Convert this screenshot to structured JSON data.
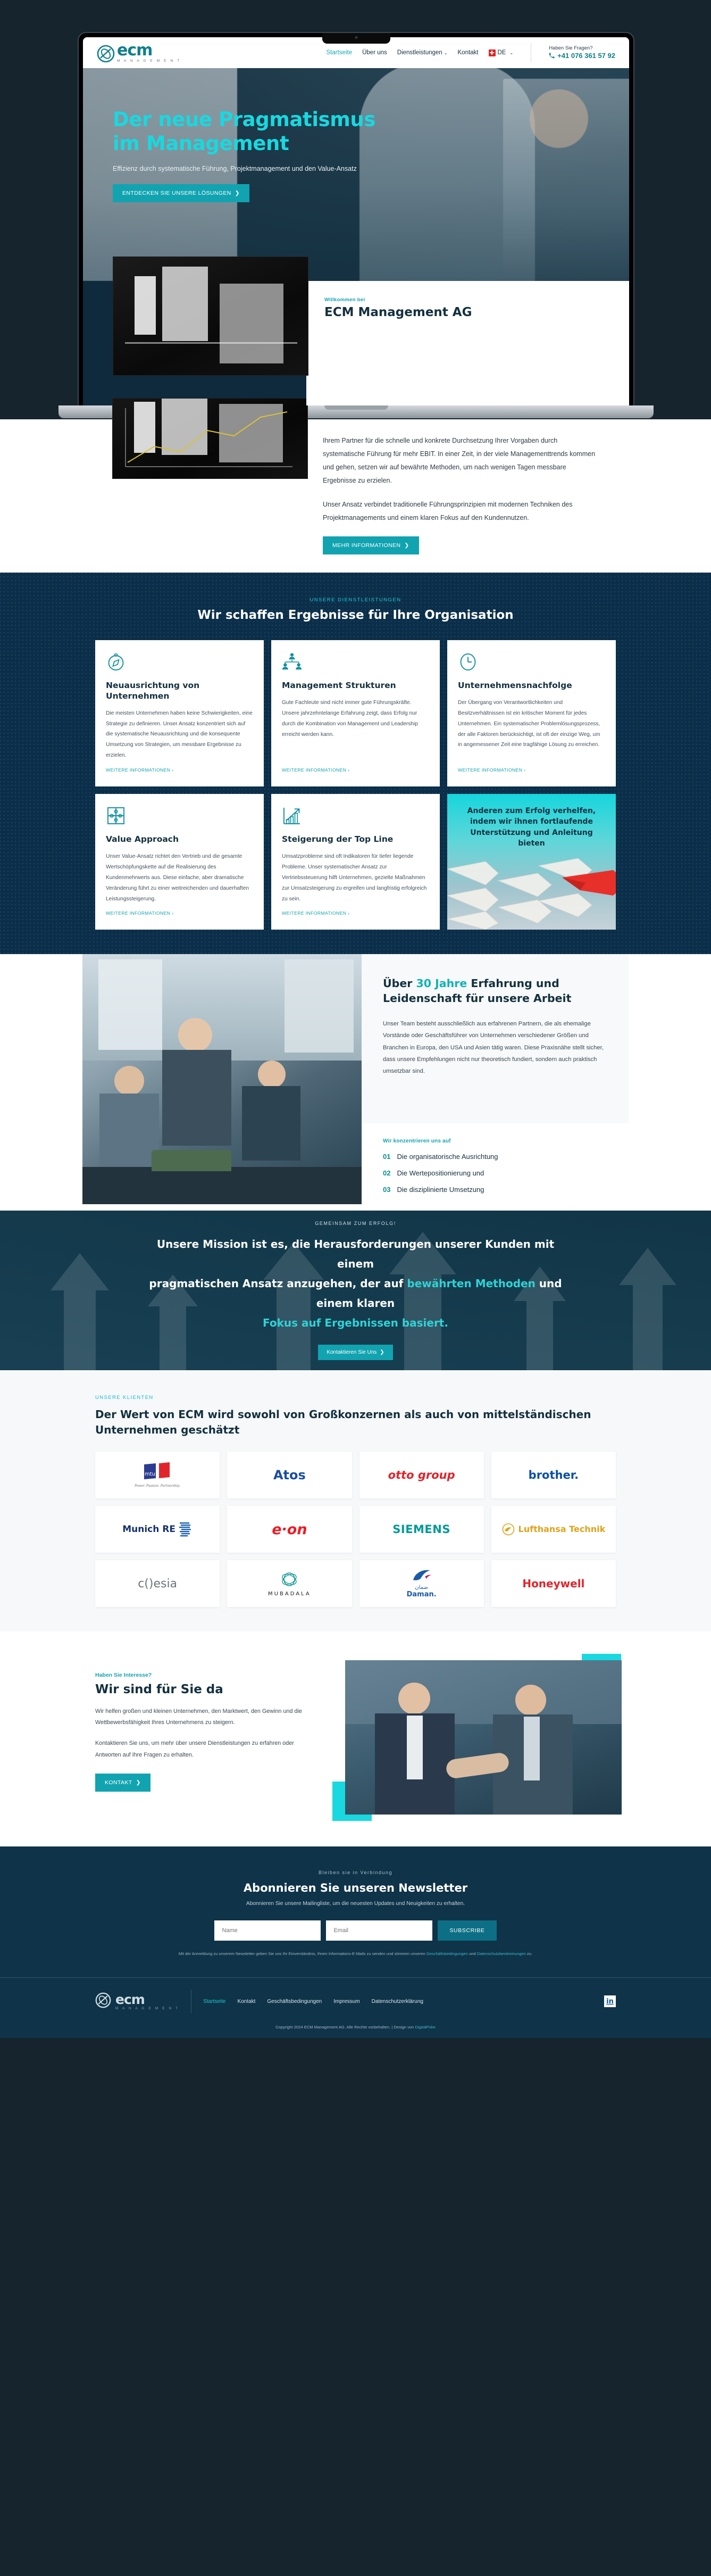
{
  "brand": {
    "name": "ecm",
    "tagline": "M A N A G E M E N T",
    "accent_teal": "#12a3b0",
    "accent_cyan": "#19d8e0",
    "dark_navy": "#0f3348",
    "services_bg": "#0b2f4a"
  },
  "header": {
    "nav": [
      {
        "label": "Startseite",
        "active": true
      },
      {
        "label": "Über uns",
        "active": false
      },
      {
        "label": "Dienstleistungen",
        "active": false,
        "caret": true
      },
      {
        "label": "Kontakt",
        "active": false
      }
    ],
    "lang": {
      "code": "DE",
      "flag": "swiss-flag-icon",
      "caret": "⌄"
    },
    "contact": {
      "question": "Haben Sie Fragen?",
      "phone": "+41 076 361 57 92",
      "phone_icon": "phone-icon"
    }
  },
  "hero": {
    "title_line1": "Der neue Pragmatismus",
    "title_line2": "im Management",
    "subtitle": "Effizienz durch systematische Führung, Projektmanagement und den Value-Ansatz",
    "cta": "ENTDECKEN SIE UNSERE LÖSUNGEN",
    "cta_arrow": "❯"
  },
  "welcome": {
    "eyebrow": "Willkommen bei",
    "title": "ECM Management AG",
    "paragraphs": [
      "Ihrem Partner für die schnelle und konkrete Durchsetzung Ihrer Vorgaben durch systematische Führung für mehr EBIT. In einer Zeit, in der viele Managementtrends kommen und gehen, setzen wir auf bewährte Methoden, um nach wenigen Tagen messbare Ergebnisse zu erzielen.",
      "Unser Ansatz verbindet traditionelle Führungsprinzipien mit modernen Techniken des Projektmanagements und einem klaren Fokus auf den Kundennutzen."
    ],
    "cta": "MEHR INFORMATIONEN",
    "cta_arrow": "❯"
  },
  "services": {
    "eyebrow": "UNSERE DIENSTLEISTUNGEN",
    "title": "Wir schaffen Ergebnisse für Ihre Organisation",
    "link_label": "WEITERE INFORMATIONEN ›",
    "cards": [
      {
        "icon": "compass-icon",
        "title": "Neuausrichtung von Unternehmen",
        "body": "Die meisten Unternehmen haben keine Schwierigkeiten, eine Strategie zu definieren. Unser Ansatz konzentriert sich auf die systematische Neuausrichtung und die konsequente Umsetzung von Strategien, um messbare Ergebnisse zu erzielen."
      },
      {
        "icon": "org-chart-icon",
        "title": "Management Strukturen",
        "body": "Gute Fachleute sind nicht immer gute Führungskräfte. Unsere jahrzehntelange Erfahrung zeigt, dass Erfolg nur durch die Kombination von Management und Leadership erreicht werden kann."
      },
      {
        "icon": "clock-icon",
        "title": "Unternehmensnachfolge",
        "body": "Der Übergang von Verantwortlichkeiten und Besitzverhältnissen ist ein kritischer Moment für jedes Unternehmen. Ein systematischer Problemlösungsprozess, der alle Faktoren berücksichtigt, ist oft der einzige Weg, um in angemessener Zeit eine tragfähige Lösung zu erreichen."
      },
      {
        "icon": "puzzle-icon",
        "title": "Value Approach",
        "body": "Unser Value-Ansatz richtet den Vertrieb und die gesamte Wertschöpfungskette auf die Realisierung des Kundenmehrwerts aus. Diese einfache, aber dramatische Veränderung führt zu einer weitreichenden und dauerhaften Leistungssteigerung."
      },
      {
        "icon": "growth-chart-icon",
        "title": "Steigerung der Top Line",
        "body": "Umsatzprobleme sind oft Indikatoren für tiefer liegende Probleme. Unser systematischer Ansatz zur Vertriebssteuerung hilft Unternehmen, gezielte Maßnahmen zur Umsatzsteigerung zu ergreifen und langfristig erfolgreich zu sein."
      }
    ],
    "promo": "Anderen zum Erfolg verhelfen, indem wir ihnen fortlaufende Unterstützung und Anleitung bieten"
  },
  "about": {
    "title_pre": "Über ",
    "title_highlight": "30 Jahre",
    "title_post": " Erfahrung und Leidenschaft für unsere Arbeit",
    "body": "Unser Team besteht ausschließlich aus erfahrenen Partnern, die als ehemalige Vorstände oder Geschäftsführer von Unternehmen verschiedener Größen und Branchen in Europa, den USA und Asien tätig waren. Diese Praxisnähe stellt sicher, dass unsere Empfehlungen nicht nur theoretisch fundiert, sondern auch praktisch umsetzbar sind.",
    "focus_label": "Wir konzentrieren uns auf",
    "focus_items": [
      {
        "num": "01",
        "text": "Die organisatorische Ausrichtung"
      },
      {
        "num": "02",
        "text": "Die Wertepositionierung und"
      },
      {
        "num": "03",
        "text": "Die disziplinierte Umsetzung"
      }
    ]
  },
  "mission": {
    "eyebrow": "GEMEINSAM ZUM ERFOLG!",
    "line1_a": "Unsere Mission ist es, die Herausforderungen unserer Kunden mit einem",
    "line2_a": "pragmatischen Ansatz anzugehen, der auf ",
    "line2_hl": "bewährten Methoden",
    "line2_b": " und einem klaren",
    "line3_hl": "Fokus auf Ergebnissen basiert.",
    "cta": "Kontaktieren Sie Uns",
    "cta_arrow": "❯"
  },
  "clients": {
    "eyebrow": "UNSERE KLIENTEN",
    "title": "Der Wert von ECM wird sowohl von Großkonzernen als auch von mittelständischen Unternehmen geschätzt",
    "logos": [
      {
        "name": "mtu",
        "sub": "Power. Passion. Partnership.",
        "kind": "mtu"
      },
      {
        "name": "Atos",
        "kind": "atos"
      },
      {
        "name": "otto group",
        "kind": "otto"
      },
      {
        "name": "brother.",
        "kind": "brother"
      },
      {
        "name": "Munich RE",
        "kind": "munichre"
      },
      {
        "name": "e·on",
        "kind": "eon"
      },
      {
        "name": "SIEMENS",
        "kind": "siemens"
      },
      {
        "name": "Lufthansa Technik",
        "kind": "lufthansa"
      },
      {
        "name": "c()esia",
        "kind": "coesia"
      },
      {
        "name": "MUBADALA",
        "kind": "mubadala"
      },
      {
        "name": "Daman.",
        "sub": "ضمان",
        "kind": "daman"
      },
      {
        "name": "Honeywell",
        "kind": "honeywell"
      }
    ]
  },
  "contact": {
    "eyebrow": "Haben Sie Interesse?",
    "title": "Wir sind für Sie da",
    "p1": "Wir helfen großen und kleinen Unternehmen, den Marktwert, den Gewinn und die Wettbewerbsfähigkeit Ihres Unternehmens zu steigern.",
    "p2": "Kontaktieren Sie uns, um mehr über unsere Dienstleistungen zu erfahren oder Antworten auf Ihre Fragen zu erhalten.",
    "cta": "KONTAKT",
    "cta_arrow": "❯"
  },
  "newsletter": {
    "eyebrow": "Bleiben sie in Verbindung",
    "title": "Abonnieren Sie unseren Newsletter",
    "subtitle": "Abonnieren Sie unsere Mailingliste, um die neuesten Updates und Neuigkeiten zu erhalten.",
    "name_placeholder": "Name",
    "email_placeholder": "Email",
    "submit": "SUBSCRIBE",
    "legal_pre": "Mit der Anmeldung zu unserem Newsletter geben Sie uns Ihr Einverständnis, Ihnen Informations-E-Mails zu senden und stimmen unseren ",
    "legal_link1": "Geschäftsbedingungen",
    "legal_mid": " und ",
    "legal_link2": "Datenschutzbestimmungen",
    "legal_post": " zu."
  },
  "footer": {
    "links": [
      {
        "label": "Startseite",
        "active": true
      },
      {
        "label": "Kontakt",
        "active": false
      },
      {
        "label": "Geschäftsbedingungen",
        "active": false
      },
      {
        "label": "Impressum",
        "active": false
      },
      {
        "label": "Datenschutzerklärung",
        "active": false
      }
    ],
    "social": {
      "name": "linkedin-icon",
      "glyph": "in"
    },
    "copyright_pre": "Copyright 2024 ECM Management AG. Alle Rechte vorbehalten. | Design von ",
    "copyright_link": "DigitalPoke"
  }
}
